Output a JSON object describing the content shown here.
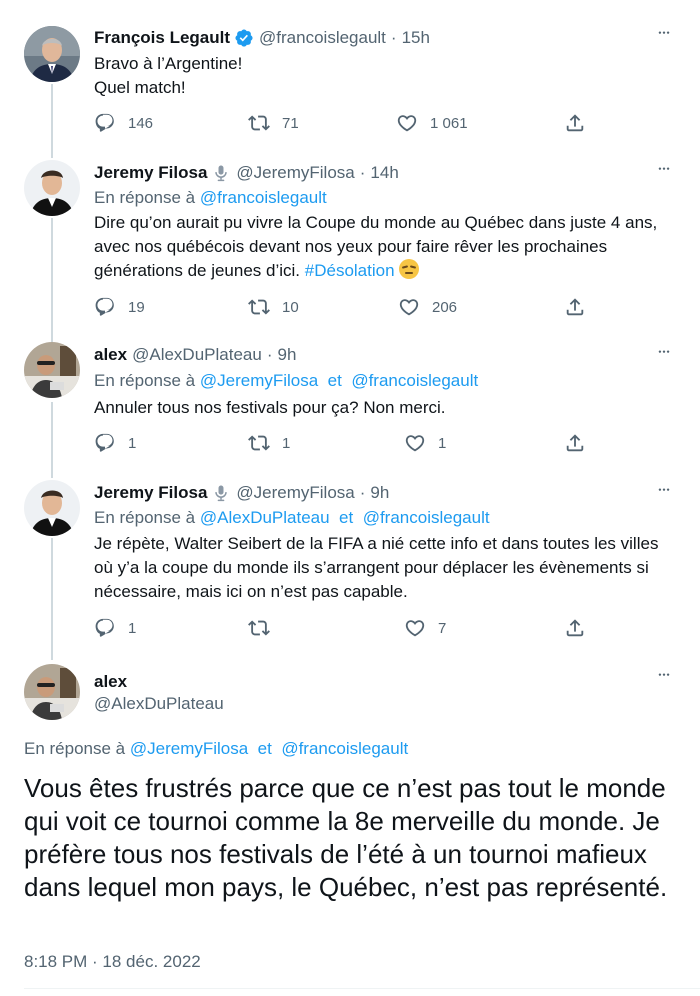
{
  "tweets": [
    {
      "name": "François Legault",
      "handle": "@francoislegault",
      "time": "15h",
      "lines": [
        "Bravo à l’Argentine!",
        "Quel match!"
      ],
      "replies": "146",
      "retweets": "71",
      "likes": "1 061",
      "verified": true
    },
    {
      "name": "Jeremy Filosa",
      "handle": "@JeremyFilosa",
      "time": "14h",
      "reply_label": "En réponse à",
      "reply_to_1": "@francoislegault",
      "text": "Dire qu’on aurait pu vivre la Coupe du monde au Québec dans juste 4 ans, avec nos québécois devant nos yeux pour faire rêver les prochaines générations de jeunes d’ici.",
      "hashtag": "#Désolation",
      "replies": "19",
      "retweets": "10",
      "likes": "206"
    },
    {
      "name": "alex",
      "handle": "@AlexDuPlateau",
      "time": "9h",
      "reply_label": "En réponse à",
      "reply_to_1": "@JeremyFilosa",
      "reply_sep": "et",
      "reply_to_2": "@francoislegault",
      "text": "Annuler tous nos festivals pour ça? Non merci.",
      "replies": "1",
      "retweets": "1",
      "likes": "1"
    },
    {
      "name": "Jeremy Filosa",
      "handle": "@JeremyFilosa",
      "time": "9h",
      "reply_label": "En réponse à",
      "reply_to_1": "@AlexDuPlateau",
      "reply_sep": "et",
      "reply_to_2": "@francoislegault",
      "text": "Je répète, Walter Seibert de la FIFA a nié cette info et dans toutes les villes où y’a la coupe du monde ils  s’arrangent pour déplacer les évènements si nécessaire, mais ici on n’est pas capable.",
      "replies": "1",
      "retweets": "",
      "likes": "7"
    }
  ],
  "main": {
    "name": "alex",
    "handle": "@AlexDuPlateau",
    "reply_label": "En réponse à",
    "reply_to_1": "@JeremyFilosa",
    "reply_sep": "et",
    "reply_to_2": "@francoislegault",
    "text": "Vous êtes frustrés parce que ce n’est pas tout le monde qui voit ce tournoi comme la 8e merveille du monde. Je préfère tous nos festivals de l’été à un tournoi mafieux dans lequel mon pays, le Québec, n’est pas représenté.",
    "timestamp": "8:18 PM · 18 déc. 2022"
  },
  "colors": {
    "link": "#1d9bf0",
    "muted": "#536471",
    "text": "#0f1419",
    "verified": "#1d9bf0",
    "thread": "#cfd9de"
  },
  "icons": [
    "more-icon",
    "reply-icon",
    "retweet-icon",
    "like-icon",
    "share-icon",
    "verified-badge-icon",
    "microphone-icon",
    "unamused-face-emoji"
  ]
}
